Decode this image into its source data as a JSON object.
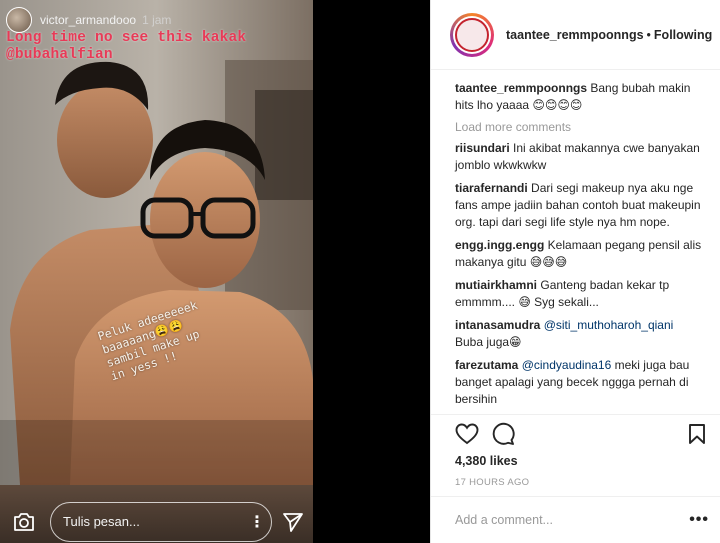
{
  "story": {
    "username": "victor_armandooo",
    "time": "1 jam",
    "caption_lines": [
      "Long time no see this kakak",
      "@bubahalfian"
    ],
    "handwrite_lines": [
      "Peluk adeeeeeek",
      "baaaaang😩😩",
      "sambil make up",
      "in yess !!"
    ],
    "message_placeholder": "Tulis pesan...",
    "more_label": "⋮"
  },
  "post": {
    "username": "taantee_remmpoonngs",
    "separator": "•",
    "follow_label": "Following",
    "load_more": "Load more comments",
    "comments": [
      {
        "user": "taantee_remmpoonngs",
        "text": "Bang bubah makin hits lho yaaaa 😊😊😊😊"
      },
      {
        "user": "riisundari",
        "text": "Ini akibat makannya cwe banyakan jomblo wkwkwkw"
      },
      {
        "user": "tiarafernandi",
        "text": "Dari segi makeup nya aku nge fans ampe jadiin bahan contoh buat makeupin org. tapi dari segi life style nya hm nope."
      },
      {
        "user": "engg.ingg.engg",
        "text": "Kelamaan pegang pensil alis makanya gitu 😅😅😅"
      },
      {
        "user": "mutiairkhamni",
        "text": "Ganteng badan kekar tp emmmm.... 😅 Syg sekali..."
      },
      {
        "user": "intanasamudra",
        "mention": "@siti_muthoharoh_qiani",
        "text": "Buba juga😁"
      },
      {
        "user": "farezutama",
        "mention": "@cindyaudina16",
        "text": "meki juga bau banget apalagi yang becek nggga pernah di bersihin"
      }
    ],
    "likes": "4,380 likes",
    "timestamp": "17 HOURS AGO",
    "add_comment_placeholder": "Add a comment...",
    "options_label": "•••"
  }
}
